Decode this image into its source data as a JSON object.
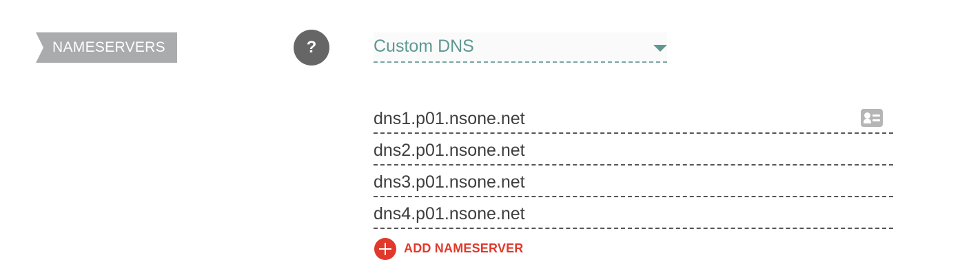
{
  "section": {
    "label": "NAMESERVERS"
  },
  "help": {
    "icon_name": "question-icon",
    "glyph": "?"
  },
  "dns_type": {
    "selected": "Custom DNS",
    "caret_icon": "caret-down-icon"
  },
  "nameservers": [
    "dns1.p01.nsone.net",
    "dns2.p01.nsone.net",
    "dns3.p01.nsone.net",
    "dns4.p01.nsone.net"
  ],
  "row_icon": "contact-card-icon",
  "add_button": {
    "label": "ADD NAMESERVER",
    "icon_name": "plus-circle-icon"
  },
  "colors": {
    "label_bg": "#a9abad",
    "help_bg": "#666666",
    "select_text": "#5e9893",
    "accent_red": "#e0392b",
    "text_dark": "#3f3f3f"
  }
}
